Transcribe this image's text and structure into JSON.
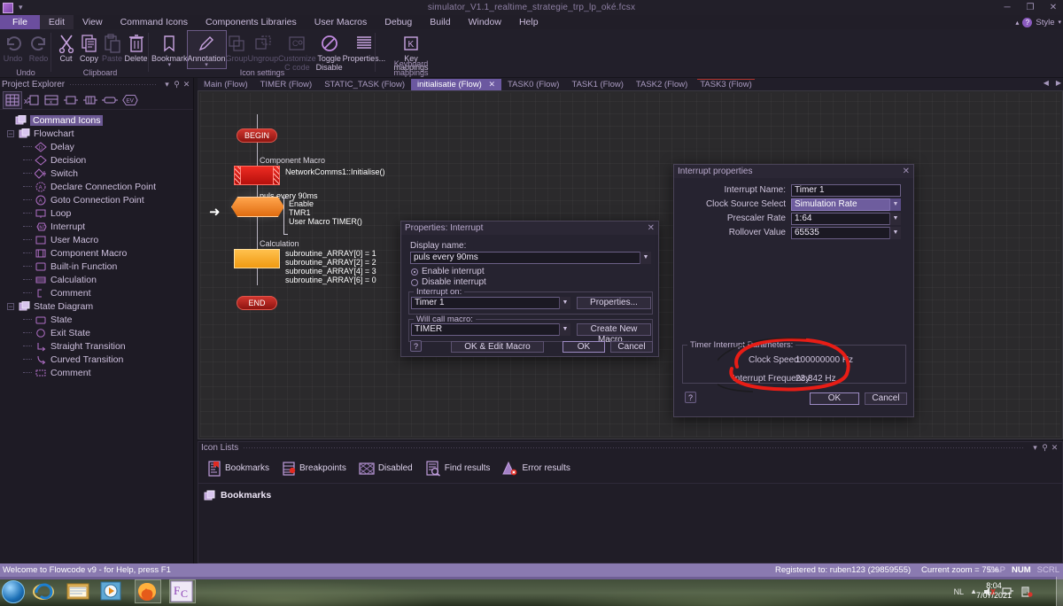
{
  "titlebar": {
    "title": "simulator_V1.1_realtime_strategie_trp_lp_oké.fcsx",
    "minimize": "─",
    "restore": "❐",
    "close": "✕"
  },
  "menubar": {
    "items": [
      "File",
      "Edit",
      "View",
      "Command Icons",
      "Components Libraries",
      "User Macros",
      "Debug",
      "Build",
      "Window",
      "Help"
    ],
    "style_label": "Style",
    "help_glyph": "?"
  },
  "ribbon": {
    "groups": [
      {
        "label": "Undo",
        "buttons": [
          {
            "name": "undo-button",
            "caption": "Undo",
            "icon": "undo-icon",
            "disabled": true
          },
          {
            "name": "redo-button",
            "caption": "Redo",
            "icon": "redo-icon",
            "disabled": true
          }
        ]
      },
      {
        "label": "Clipboard",
        "buttons": [
          {
            "name": "cut-button",
            "caption": "Cut",
            "icon": "scissors-icon",
            "disabled": false
          },
          {
            "name": "copy-button",
            "caption": "Copy",
            "icon": "copy-icon",
            "disabled": false
          },
          {
            "name": "paste-button",
            "caption": "Paste",
            "icon": "paste-icon",
            "disabled": true
          },
          {
            "name": "delete-button",
            "caption": "Delete",
            "icon": "trash-icon",
            "disabled": false
          }
        ]
      },
      {
        "label": "Icon settings",
        "buttons": [
          {
            "name": "bookmark-button",
            "caption": "Bookmark",
            "icon": "bookmark-icon",
            "disabled": false,
            "caret": true
          },
          {
            "name": "annotation-button",
            "caption": "Annotation",
            "icon": "pencil-icon",
            "disabled": false,
            "caret": true,
            "selected": true
          },
          {
            "name": "group-button",
            "caption": "Group",
            "icon": "group-icon",
            "disabled": true
          },
          {
            "name": "ungroup-button",
            "caption": "Ungroup",
            "icon": "ungroup-icon",
            "disabled": true
          },
          {
            "name": "customize-c-code-button",
            "caption": "Customize C code",
            "icon": "c-code-icon",
            "disabled": true
          },
          {
            "name": "toggle-disable-button",
            "caption": "Toggle Disable",
            "icon": "no-entry-icon",
            "disabled": false
          },
          {
            "name": "properties-button",
            "caption": "Properties...",
            "icon": "lines-icon",
            "disabled": false
          }
        ]
      },
      {
        "label": "Keyboard mappings",
        "buttons": [
          {
            "name": "key-mappings-button",
            "caption": "Key mappings",
            "icon": "key-letter-icon",
            "disabled": false
          }
        ]
      }
    ]
  },
  "project_explorer": {
    "title": "Project Explorer",
    "header_buttons": [
      "▾",
      "⚲",
      "✕"
    ],
    "toolbar_icons": [
      "grid-icon",
      "x-component-icon",
      "macro-icon",
      "variable-icon",
      "array-icon",
      "constant-icon",
      "event-icon"
    ],
    "tree": [
      {
        "label": "Command Icons",
        "level": 0,
        "icon": "folder-icon",
        "selected": true,
        "twisty": ""
      },
      {
        "label": "Flowchart",
        "level": 1,
        "icon": "folder-icon",
        "selected": false,
        "twisty": "−"
      },
      {
        "label": "Delay",
        "level": 2,
        "icon": "delay-icon"
      },
      {
        "label": "Decision",
        "level": 2,
        "icon": "decision-icon"
      },
      {
        "label": "Switch",
        "level": 2,
        "icon": "switch-icon"
      },
      {
        "label": "Declare Connection Point",
        "level": 2,
        "icon": "declare-connection-point-icon"
      },
      {
        "label": "Goto Connection Point",
        "level": 2,
        "icon": "goto-connection-point-icon"
      },
      {
        "label": "Loop",
        "level": 2,
        "icon": "loop-icon"
      },
      {
        "label": "Interrupt",
        "level": 2,
        "icon": "interrupt-icon"
      },
      {
        "label": "User Macro",
        "level": 2,
        "icon": "user-macro-icon"
      },
      {
        "label": "Component Macro",
        "level": 2,
        "icon": "component-macro-icon"
      },
      {
        "label": "Built-in Function",
        "level": 2,
        "icon": "built-in-function-icon"
      },
      {
        "label": "Calculation",
        "level": 2,
        "icon": "calculation-icon"
      },
      {
        "label": "Comment",
        "level": 2,
        "icon": "comment-icon"
      },
      {
        "label": "State Diagram",
        "level": 1,
        "icon": "folder-icon",
        "selected": false,
        "twisty": "−"
      },
      {
        "label": "State",
        "level": 2,
        "icon": "state-icon"
      },
      {
        "label": "Exit State",
        "level": 2,
        "icon": "exit-state-icon"
      },
      {
        "label": "Straight Transition",
        "level": 2,
        "icon": "straight-transition-icon"
      },
      {
        "label": "Curved Transition",
        "level": 2,
        "icon": "curved-transition-icon"
      },
      {
        "label": "Comment",
        "level": 2,
        "icon": "comment-icon"
      }
    ]
  },
  "doctabs": {
    "tabs": [
      {
        "label": "Main (Flow)",
        "active": false,
        "modified": false
      },
      {
        "label": "TIMER (Flow)",
        "active": false,
        "modified": false
      },
      {
        "label": "STATIC_TASK (Flow)",
        "active": false,
        "modified": false
      },
      {
        "label": "initialisatie (Flow)",
        "active": true,
        "modified": false,
        "close": "✕"
      },
      {
        "label": "TASK0 (Flow)",
        "active": false,
        "modified": false
      },
      {
        "label": "TASK1 (Flow)",
        "active": false,
        "modified": false
      },
      {
        "label": "TASK2 (Flow)",
        "active": false,
        "modified": false
      },
      {
        "label": "TASK3 (Flow)",
        "active": false,
        "modified": true
      }
    ],
    "nav_prev": "◀",
    "nav_next": "▶"
  },
  "flowchart": {
    "begin_label": "BEGIN",
    "end_label": "END",
    "component_macro": {
      "caption": "Component Macro",
      "text": "NetworkComms1::Initialise()"
    },
    "interrupt": {
      "caption": "puls every 90ms",
      "lines": [
        "Enable",
        "TMR1",
        "User Macro TIMER()"
      ]
    },
    "calculation": {
      "caption": "Calculation",
      "lines": [
        "subroutine_ARRAY[0] = 1",
        "subroutine_ARRAY[2] = 2",
        "subroutine_ARRAY[4] = 3",
        "subroutine_ARRAY[6] = 0"
      ]
    },
    "cursor_glyph": "➜"
  },
  "properties_dialog": {
    "title": "Properties: Interrupt",
    "close": "✕",
    "display_name_label": "Display name:",
    "display_name_value": "puls every 90ms",
    "enable_label": "Enable interrupt",
    "disable_label": "Disable interrupt",
    "enable_selected": true,
    "interrupt_on_group": "Interrupt on:",
    "interrupt_on_value": "Timer 1",
    "properties_button": "Properties...",
    "will_call_macro_group": "Will call macro:",
    "will_call_macro_value": "TIMER",
    "create_new_macro_button": "Create New Macro...",
    "ok_edit_macro_button": "OK & Edit Macro",
    "ok_button": "OK",
    "cancel_button": "Cancel",
    "help_glyph": "?"
  },
  "interrupt_properties_dialog": {
    "title": "Interrupt properties",
    "close": "✕",
    "fields": [
      {
        "label": "Interrupt Name:",
        "value": "Timer 1",
        "type": "text",
        "highlighted": false
      },
      {
        "label": "Clock Source Select",
        "value": "Simulation Rate",
        "type": "combo",
        "highlighted": true
      },
      {
        "label": "Prescaler Rate",
        "value": "1:64",
        "type": "combo",
        "highlighted": false
      },
      {
        "label": "Rollover Value",
        "value": "65535",
        "type": "combo",
        "highlighted": false
      }
    ],
    "params_group_title": "Timer Interrupt Parameters:",
    "params": [
      {
        "label": "Clock Speed:",
        "value": "100000000 Hz"
      },
      {
        "label": "Interrupt Frequency:",
        "value": "23.842 Hz"
      }
    ],
    "ok_button": "OK",
    "cancel_button": "Cancel",
    "help_glyph": "?",
    "annotation_color": "#e81d16"
  },
  "icon_lists": {
    "title": "Icon Lists",
    "header_buttons": [
      "▾",
      "⚲",
      "✕"
    ],
    "tabs": [
      {
        "label": "Bookmarks",
        "icon": "bookmark-page-icon"
      },
      {
        "label": "Breakpoints",
        "icon": "breakpoint-icon"
      },
      {
        "label": "Disabled",
        "icon": "disabled-hatch-icon"
      },
      {
        "label": "Find results",
        "icon": "find-results-icon"
      },
      {
        "label": "Error results",
        "icon": "error-results-icon"
      }
    ],
    "body_label": "Bookmarks",
    "body_icon": "folder-icon"
  },
  "statusbar": {
    "hint": "Welcome to Flowcode v9 - for Help, press F1",
    "registered": "Registered to: ruben123 (29859555)",
    "zoom": "Current zoom = 75%",
    "indicators": [
      "CAP",
      "NUM",
      "SCRL"
    ]
  },
  "taskbar": {
    "start": "start-orb-icon",
    "items": [
      "internet-explorer-icon",
      "file-explorer-icon",
      "media-player-icon",
      "firefox-icon",
      "flowcode-icon"
    ],
    "language": "NL",
    "tray_icons": [
      "show-hidden-icon",
      "volume-icon",
      "network-icon",
      "action-center-icon"
    ],
    "time": "8:04",
    "date": "7/07/2021"
  }
}
